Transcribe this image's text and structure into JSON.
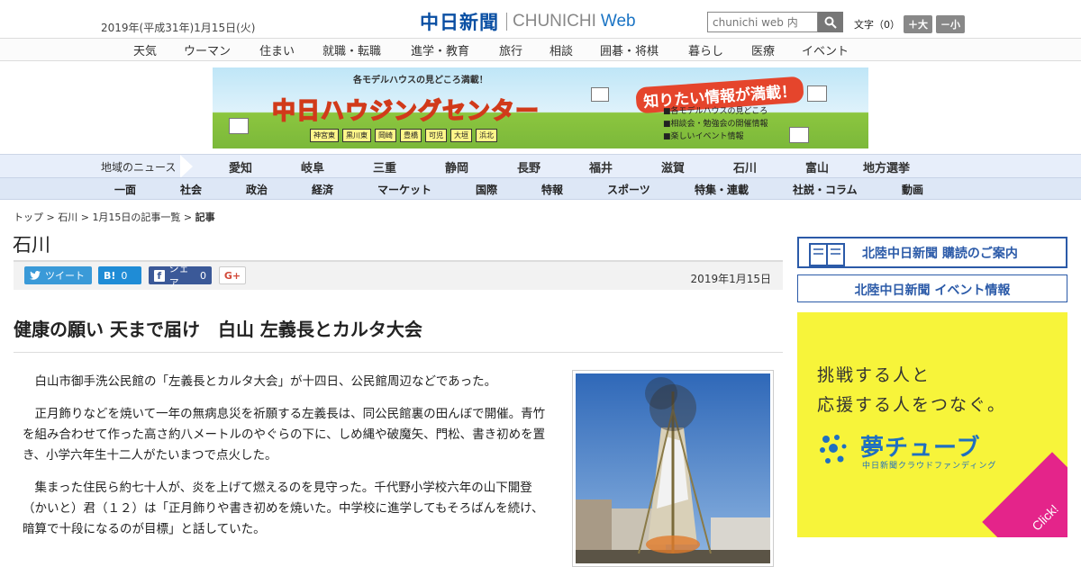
{
  "header": {
    "date": "2019年(平成31年)1月15日(火)",
    "logo_jp": "中日新聞",
    "logo_en": "CHUNICHI",
    "logo_web": "Web",
    "search_placeholder": "chunichi web 内",
    "fontsize_label": "文字（0）",
    "fontsize_up": "＋大",
    "fontsize_down": "－小"
  },
  "nav_categories": [
    "天気",
    "ウーマン",
    "住まい",
    "就職・転職",
    "進学・教育",
    "旅行",
    "相談",
    "囲碁・将棋",
    "暮らし",
    "医療",
    "イベント"
  ],
  "banner": {
    "top_text": "各モデルハウスの見どころ満載！",
    "title": "中日ハウジングセンター",
    "cities": [
      "神宮東",
      "黒川東",
      "岡崎",
      "豊橋",
      "可児",
      "大垣",
      "浜北"
    ],
    "tagline": "知りたい情報が満載！",
    "list": [
      "■各モデルハウスの見どころ",
      "■相談会・勉強会の開催情報",
      "■楽しいイベント情報"
    ]
  },
  "region_nav": {
    "label": "地域のニュース",
    "items": [
      "愛知",
      "岐阜",
      "三重",
      "静岡",
      "長野",
      "福井",
      "滋賀",
      "石川",
      "富山",
      "地方選挙"
    ]
  },
  "genre_nav": [
    "一面",
    "社会",
    "政治",
    "経済",
    "マーケット",
    "国際",
    "特報",
    "スポーツ",
    "特集・連載",
    "社説・コラム",
    "動画"
  ],
  "breadcrumb": {
    "top": "トップ",
    "region": "石川",
    "list": "1月15日の記事一覧",
    "current": "記事",
    "sep": " > "
  },
  "section_title": "石川",
  "share": {
    "tweet": "ツイート",
    "hatena": "B!",
    "hatena_count": "0",
    "facebook": "シェア",
    "facebook_count": "0",
    "gplus": "G+"
  },
  "pub_date": "2019年1月15日",
  "headline": "健康の願い 天まで届け　白山 左義長とカルタ大会",
  "paragraphs": [
    "白山市御手洗公民館の「左義長とカルタ大会」が十四日、公民館周辺などであった。",
    "正月飾りなどを焼いて一年の無病息災を祈願する左義長は、同公民館裏の田んぼで開催。青竹を組み合わせて作った高さ約八メートルのやぐらの下に、しめ縄や破魔矢、門松、書き初めを置き、小学六年生十二人がたいまつで点火した。",
    "集まった住民ら約七十人が、炎を上げて燃えるのを見守った。千代野小学校六年の山下開登（かいと）君（１２）は「正月飾りや書き初めを焼いた。中学校に進学してもそろばんを続け、暗算で十段になるのが目標」と話していた。"
  ],
  "sidebar": {
    "subscribe": "北陸中日新聞 購読のご案内",
    "event": "北陸中日新聞 イベント情報",
    "ad_line1": "挑戦する人と",
    "ad_line2": "応援する人をつなぐ。",
    "ad_logo": "夢チューブ",
    "ad_sub": "中日新聞クラウドファンディング",
    "ad_click": "Click!"
  }
}
